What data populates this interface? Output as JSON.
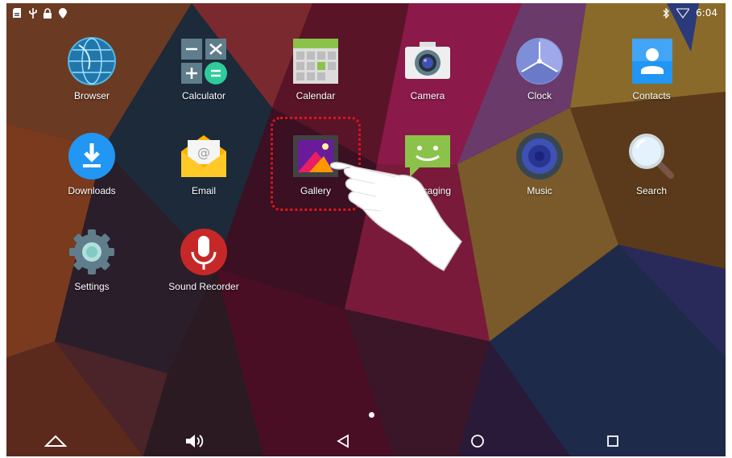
{
  "status_bar": {
    "left_icons": [
      "sd-card-icon",
      "usb-icon",
      "lock-icon",
      "location-icon"
    ],
    "right_icons": [
      "bluetooth-icon",
      "wifi-icon"
    ],
    "time": "6:04"
  },
  "apps": [
    {
      "label": "Browser",
      "icon": "globe-icon"
    },
    {
      "label": "Calculator",
      "icon": "calculator-icon"
    },
    {
      "label": "Calendar",
      "icon": "calendar-icon"
    },
    {
      "label": "Camera",
      "icon": "camera-icon"
    },
    {
      "label": "Clock",
      "icon": "clock-icon"
    },
    {
      "label": "Contacts",
      "icon": "contacts-icon"
    },
    {
      "label": "Downloads",
      "icon": "download-icon"
    },
    {
      "label": "Email",
      "icon": "email-icon"
    },
    {
      "label": "Gallery",
      "icon": "gallery-icon"
    },
    {
      "label": "Messaging",
      "icon": "messaging-icon"
    },
    {
      "label": "Music",
      "icon": "music-icon"
    },
    {
      "label": "Search",
      "icon": "search-icon"
    },
    {
      "label": "Settings",
      "icon": "settings-icon"
    },
    {
      "label": "Sound Recorder",
      "icon": "microphone-icon"
    }
  ],
  "highlight": {
    "target": "Gallery",
    "color": "#e0141b"
  },
  "nav_bar": [
    "up-arrow-icon",
    "volume-icon",
    "back-icon",
    "home-icon",
    "recents-icon"
  ]
}
